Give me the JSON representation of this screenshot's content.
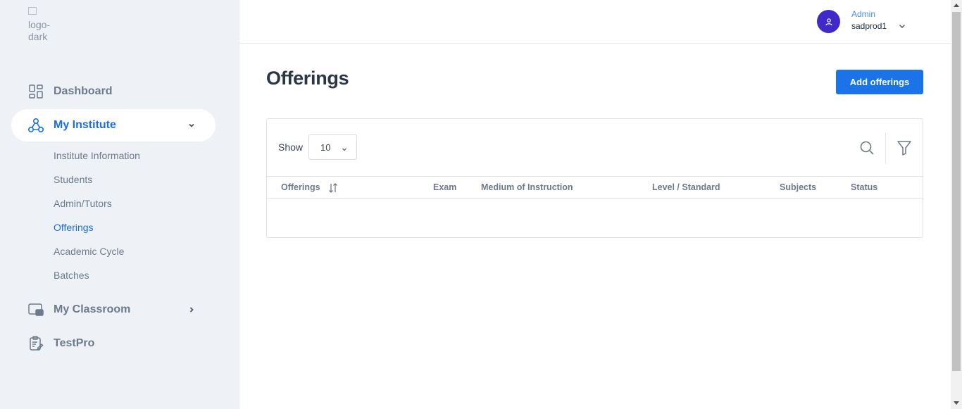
{
  "logo": {
    "alt": "logo-dark"
  },
  "sidebar": {
    "items": [
      {
        "label": "Dashboard",
        "icon": "dashboard-icon"
      },
      {
        "label": "My Institute",
        "icon": "institute-icon",
        "expanded": true
      },
      {
        "label": "My Classroom",
        "icon": "classroom-icon"
      },
      {
        "label": "TestPro",
        "icon": "testpro-icon"
      }
    ],
    "sub_items": [
      {
        "label": "Institute Information"
      },
      {
        "label": "Students"
      },
      {
        "label": "Admin/Tutors"
      },
      {
        "label": "Offerings",
        "active": true
      },
      {
        "label": "Academic Cycle"
      },
      {
        "label": "Batches"
      }
    ]
  },
  "header": {
    "user_role": "Admin",
    "user_name": "sadprod1"
  },
  "main": {
    "title": "Offerings",
    "add_button": "Add offerings",
    "show_label": "Show",
    "page_size": "10",
    "table": {
      "columns": [
        "Offerings",
        "Exam",
        "Medium of Instruction",
        "Level / Standard",
        "Subjects",
        "Status"
      ],
      "rows": []
    }
  },
  "colors": {
    "accent": "#1a73e8",
    "sidebar_bg": "#eef2f7",
    "avatar": "#3f2ac9"
  }
}
